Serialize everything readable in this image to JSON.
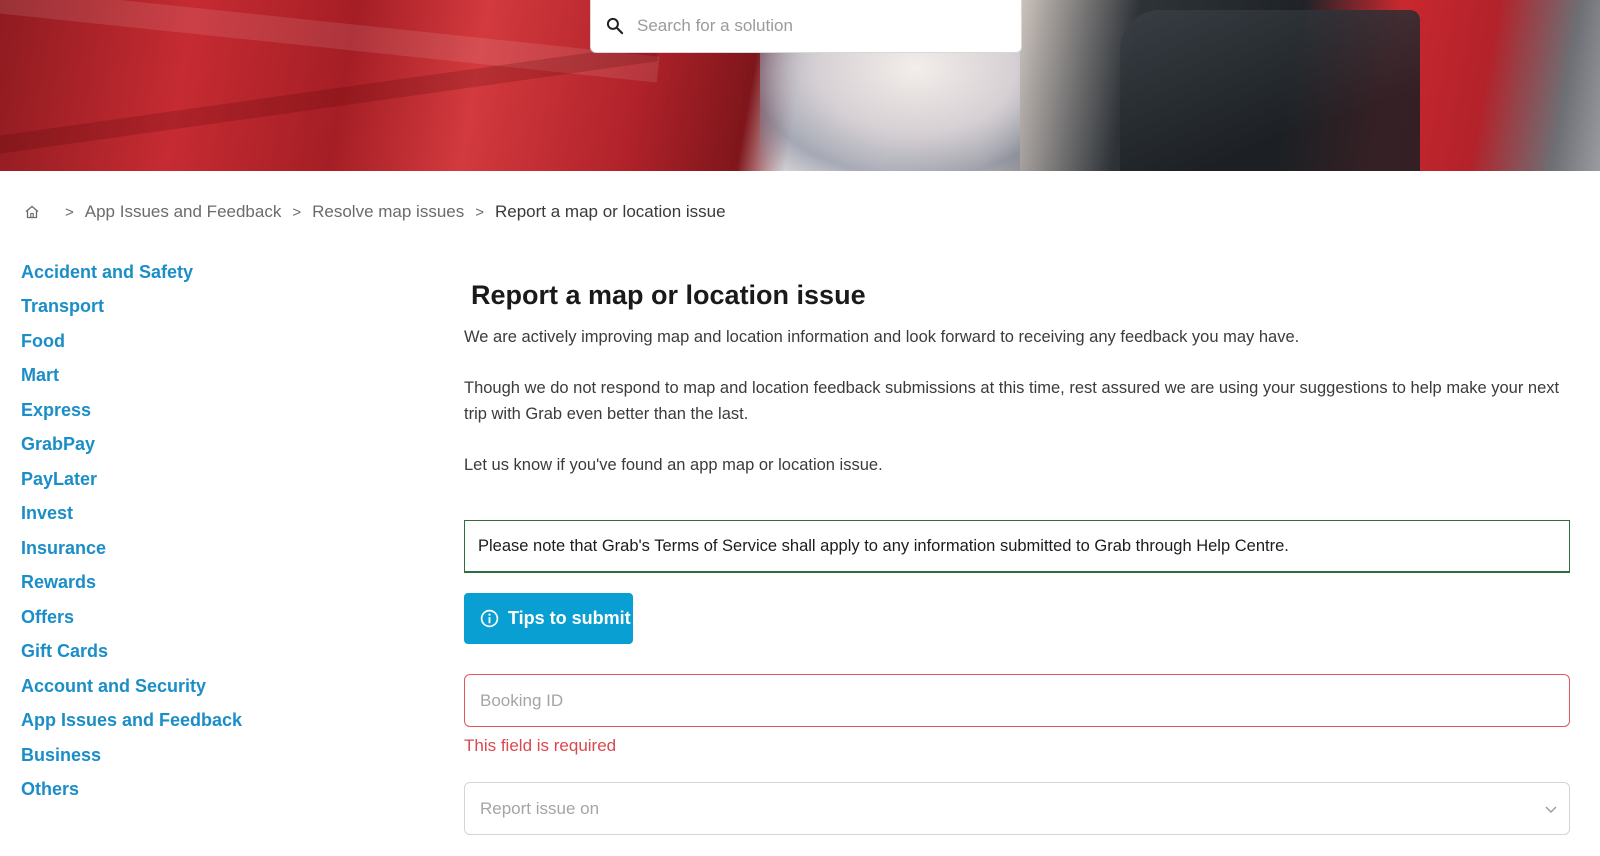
{
  "search": {
    "placeholder": "Search for a solution"
  },
  "breadcrumb": {
    "items": [
      "App Issues and Feedback",
      "Resolve map issues"
    ],
    "current": "Report a map or location issue",
    "separator": ">"
  },
  "sidebar": {
    "items": [
      {
        "label": "Accident and Safety"
      },
      {
        "label": "Transport"
      },
      {
        "label": "Food"
      },
      {
        "label": "Mart"
      },
      {
        "label": "Express"
      },
      {
        "label": "GrabPay"
      },
      {
        "label": "PayLater"
      },
      {
        "label": "Invest"
      },
      {
        "label": "Insurance"
      },
      {
        "label": "Rewards"
      },
      {
        "label": "Offers"
      },
      {
        "label": "Gift Cards"
      },
      {
        "label": "Account and Security"
      },
      {
        "label": "App Issues and Feedback"
      },
      {
        "label": "Business"
      },
      {
        "label": "Others"
      }
    ]
  },
  "main": {
    "title": "Report a map or location issue",
    "paragraphs": [
      "We are actively improving map and location information and look forward to receiving any feedback you may have.",
      "Though we do not respond to map and location feedback submissions at this time, rest assured we are using your suggestions to help make your next trip with Grab even better than the last.",
      "Let us know if you've found an app map or location issue."
    ],
    "notice": "Please note that Grab's Terms of Service shall apply to any information submitted to Grab through Help Centre.",
    "tips_button": "Tips to submit",
    "booking_field": {
      "placeholder": "Booking ID",
      "error": "This field is required"
    },
    "report_select": {
      "placeholder": "Report issue on"
    }
  },
  "colors": {
    "link": "#1b8ec7",
    "button": "#0a9fd2",
    "error": "#d9484c",
    "notice_border": "#2f6d3e"
  },
  "icons": {
    "search": "search-icon",
    "home": "home-icon",
    "info": "info-icon",
    "chevron": "chevron-down-icon"
  }
}
